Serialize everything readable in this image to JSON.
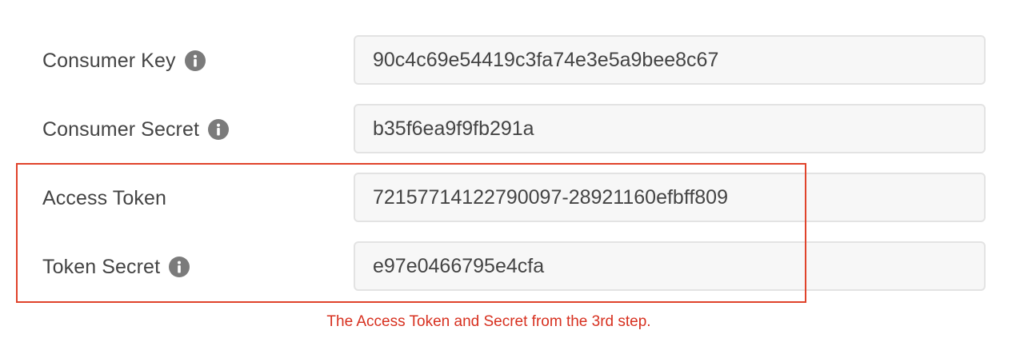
{
  "form": {
    "rows": [
      {
        "label": "Consumer Key",
        "value": "90c4c69e54419c3fa74e3e5a9bee8c67",
        "has_info": true
      },
      {
        "label": "Consumer Secret",
        "value": "b35f6ea9f9fb291a",
        "has_info": true
      },
      {
        "label": "Access Token",
        "value": "72157714122790097-28921160efbff809",
        "has_info": false
      },
      {
        "label": "Token Secret",
        "value": "e97e0466795e4cfa",
        "has_info": true
      }
    ]
  },
  "annotation": {
    "caption": "The Access Token and Secret from the 3rd step.",
    "color": "#e0432b"
  },
  "icons": {
    "info": "info-icon"
  }
}
